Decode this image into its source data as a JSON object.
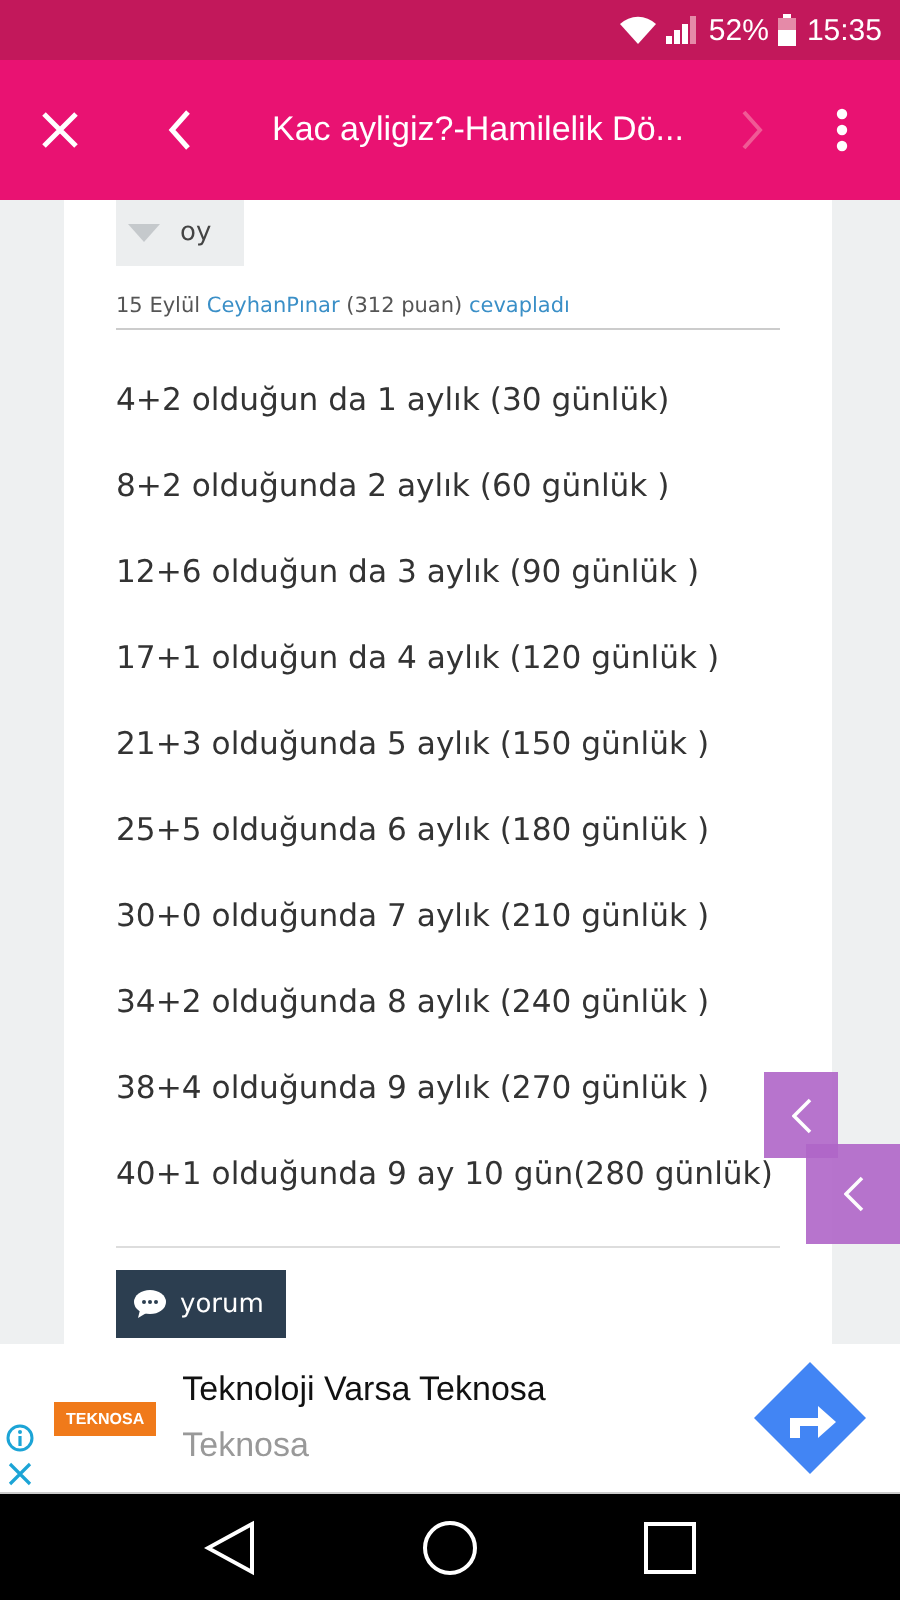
{
  "status_bar": {
    "battery_percent": "52%",
    "time": "15:35"
  },
  "toolbar": {
    "title": "Kac ayligiz?-Hamilelik Dö..."
  },
  "answer": {
    "vote_label": "oy",
    "meta": {
      "date": "15 Eylül",
      "user": "CeyhanPınar",
      "points": "(312 puan)",
      "action": "cevapladı"
    },
    "lines": [
      "4+2 olduğun da 1 aylık (30 günlük)",
      "8+2 olduğunda 2 aylık (60 günlük )",
      "12+6 olduğun da 3 aylık (90 günlük )",
      "17+1 olduğun da 4 aylık (120 günlük )",
      "21+3 olduğunda 5 aylık (150 günlük )",
      "25+5 olduğunda 6 aylık (180 günlük )",
      "30+0 olduğunda 7 aylık (210 günlük )",
      "34+2 olduğunda 8 aylık (240 günlük )",
      "38+4 olduğunda 9 aylık (270 günlük )",
      "40+1 olduğunda 9 ay 10 gün(280 günlük)"
    ],
    "comment_button": "yorum"
  },
  "ad": {
    "logo": "TEKNOSA",
    "headline": "Teknoloji Varsa Teknosa",
    "advertiser": "Teknosa"
  }
}
